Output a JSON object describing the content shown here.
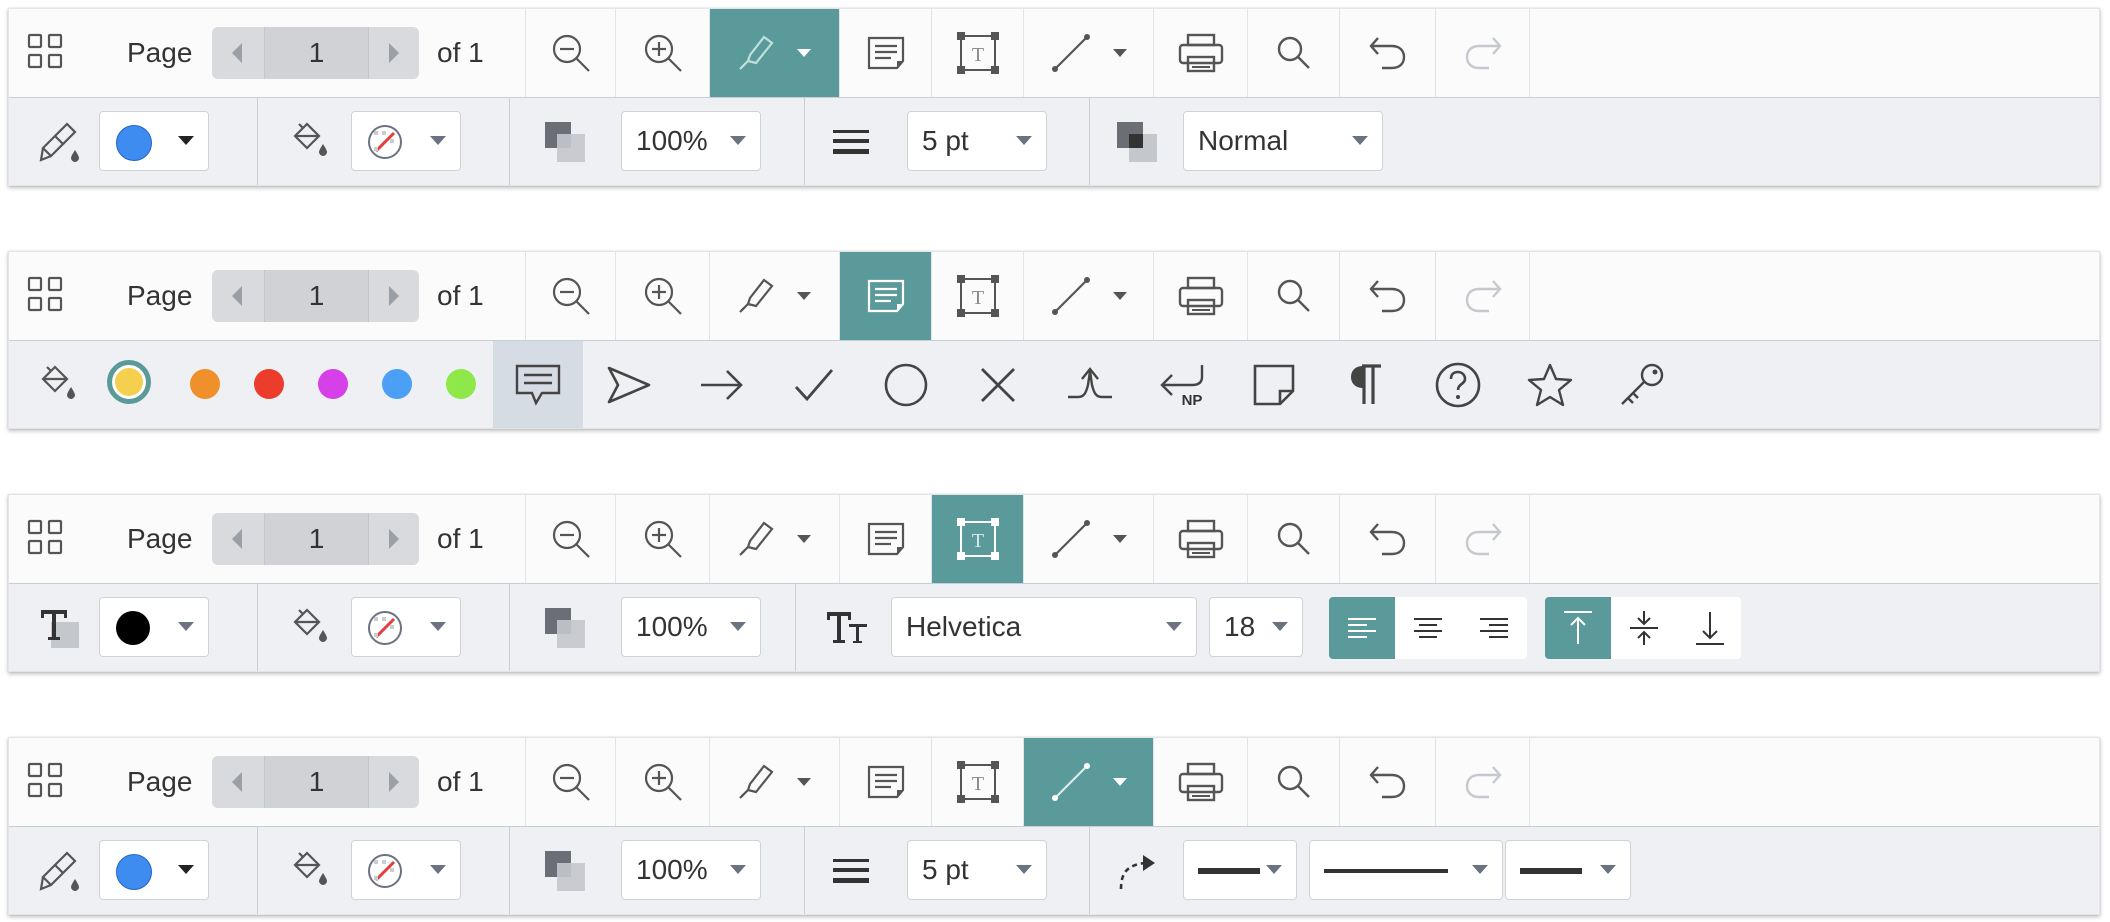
{
  "toolbar": {
    "page_label": "Page",
    "page_number": "1",
    "of_label": "of 1"
  },
  "colors": {
    "accent": "#5b9a9a",
    "blue": "#3f8cf0",
    "black": "#000000",
    "yellow": "#f5cf4e",
    "orange": "#f0902c",
    "red": "#ec3d2c",
    "magenta": "#d540e8",
    "light_blue": "#4ba0f5",
    "lime": "#8ee84a"
  },
  "panels": [
    {
      "active_tool": "highlighter-icon",
      "properties": {
        "opacity": "100%",
        "stroke_width": "5 pt",
        "blend_mode": "Normal"
      }
    },
    {
      "active_tool": "note-icon",
      "note_colors": [
        "yellow",
        "orange",
        "red",
        "magenta",
        "light_blue",
        "lime"
      ],
      "selected_note_color": "yellow",
      "note_icons": [
        "comment-icon",
        "send-icon",
        "arrow-right-icon",
        "check-icon",
        "circle-icon",
        "cross-icon",
        "insert-icon",
        "new-paragraph-icon",
        "sticky-note-icon",
        "paragraph-icon",
        "help-icon",
        "star-icon",
        "key-icon"
      ],
      "note_badge": "NP",
      "selected_note_icon": "comment-icon"
    },
    {
      "active_tool": "text-box-icon",
      "properties": {
        "opacity": "100%",
        "font_family": "Helvetica",
        "font_size": "18",
        "h_align": "left",
        "v_align": "top"
      }
    },
    {
      "active_tool": "line-icon",
      "properties": {
        "opacity": "100%",
        "stroke_width": "5 pt"
      }
    }
  ]
}
